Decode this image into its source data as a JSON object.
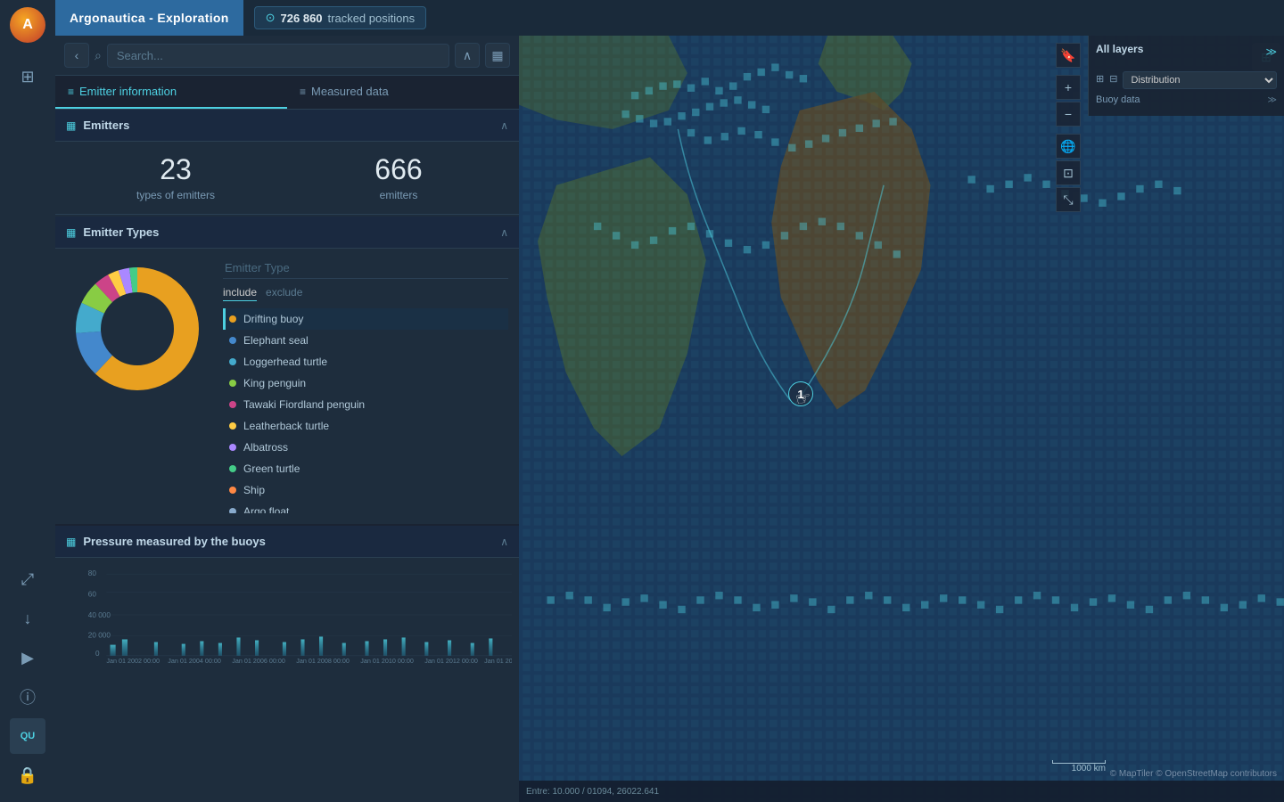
{
  "app": {
    "title": "Argonautica - Exploration",
    "tracked_positions_label": "726 860",
    "tracked_positions_suffix": "tracked positions"
  },
  "search": {
    "placeholder": "Search...",
    "back_icon": "←",
    "search_icon": "⌕"
  },
  "tabs": [
    {
      "id": "emitter-info",
      "label": "Emitter information",
      "icon": "≡",
      "active": true
    },
    {
      "id": "measured-data",
      "label": "Measured data",
      "icon": "≡",
      "active": false
    }
  ],
  "emitters_section": {
    "title": "Emitters",
    "icon": "▦",
    "stats": {
      "count": "23",
      "count_label": "types of emitters",
      "total": "666",
      "total_label": "emitters"
    }
  },
  "emitter_types_section": {
    "title": "Emitter Types",
    "icon": "▦",
    "search_placeholder": "Emitter Type",
    "include_label": "include",
    "exclude_label": "exclude",
    "items": [
      {
        "name": "Drifting buoy",
        "color": "#e8a020",
        "selected": true
      },
      {
        "name": "Elephant seal",
        "color": "#4488cc",
        "selected": false
      },
      {
        "name": "Loggerhead turtle",
        "color": "#44aacc",
        "selected": false
      },
      {
        "name": "King penguin",
        "color": "#88cc44",
        "selected": false
      },
      {
        "name": "Tawaki Fiordland penguin",
        "color": "#cc4488",
        "selected": false
      },
      {
        "name": "Leatherback turtle",
        "color": "#ffcc44",
        "selected": false
      },
      {
        "name": "Albatross",
        "color": "#aa88ff",
        "selected": false
      },
      {
        "name": "Green turtle",
        "color": "#44cc88",
        "selected": false
      },
      {
        "name": "Ship",
        "color": "#ff8844",
        "selected": false
      },
      {
        "name": "Argo float",
        "color": "#88aacc",
        "selected": false
      }
    ],
    "donut": {
      "segments": [
        {
          "color": "#e8a020",
          "pct": 0.62,
          "offset": 0
        },
        {
          "color": "#4488cc",
          "pct": 0.12,
          "offset": 62
        },
        {
          "color": "#44aacc",
          "pct": 0.08,
          "offset": 74
        },
        {
          "color": "#88cc44",
          "pct": 0.06,
          "offset": 82
        },
        {
          "color": "#cc4488",
          "pct": 0.04,
          "offset": 88
        },
        {
          "color": "#ffcc44",
          "pct": 0.03,
          "offset": 92
        },
        {
          "color": "#aa88ff",
          "pct": 0.03,
          "offset": 95
        },
        {
          "color": "#44cc88",
          "pct": 0.02,
          "offset": 98
        }
      ]
    }
  },
  "pressure_section": {
    "title": "Pressure measured by the buoys",
    "icon": "▦"
  },
  "map": {
    "cluster_label": "1",
    "all_layers_label": "All layers",
    "distribution_label": "Distribution",
    "buoy_data_label": "Buoy data",
    "attribution": "© MapTiler © OpenStreetMap contributors",
    "scale_label": "1000 km"
  },
  "bottom_bar": {
    "coord_text": "Entre: 10.000 / 01094, 26022.641"
  },
  "icons": {
    "back": "‹",
    "search": "🔍",
    "collapse_up": "∧",
    "layers": "⊞",
    "zoom_in": "+",
    "zoom_out": "−",
    "bookmark": "🔖",
    "globe": "🌐",
    "screenshot": "⊡",
    "fit": "⤡",
    "share": "⤢",
    "download": "↓",
    "play": "▶",
    "info": "ⓘ",
    "queue": "QU",
    "lock": "🔒",
    "apps": "⊞"
  }
}
